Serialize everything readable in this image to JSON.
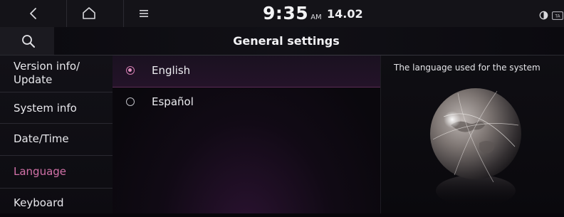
{
  "status_bar": {
    "time": "9:35",
    "ampm": "AM",
    "date": "14.02",
    "icons": [
      "back-icon",
      "home-icon",
      "menu-icon",
      "theme-icon",
      "traffic-info-icon"
    ],
    "badge_text": "TA"
  },
  "header": {
    "title": "General settings",
    "search_icon": "search-icon"
  },
  "sidebar": {
    "items": [
      {
        "label_line1": "Version info/",
        "label_line2": "Update",
        "active": false
      },
      {
        "label": "System info",
        "active": false
      },
      {
        "label": "Date/Time",
        "active": false
      },
      {
        "label": "Language",
        "active": true
      },
      {
        "label": "Keyboard",
        "active": false
      }
    ]
  },
  "languages": {
    "options": [
      {
        "label": "English",
        "selected": true
      },
      {
        "label": "Español",
        "selected": false
      }
    ]
  },
  "info_panel": {
    "description": "The language used for the system",
    "image": "globe-illustration"
  },
  "colors": {
    "accent": "#d271a8",
    "background": "#08060b",
    "bar": "#141318"
  }
}
